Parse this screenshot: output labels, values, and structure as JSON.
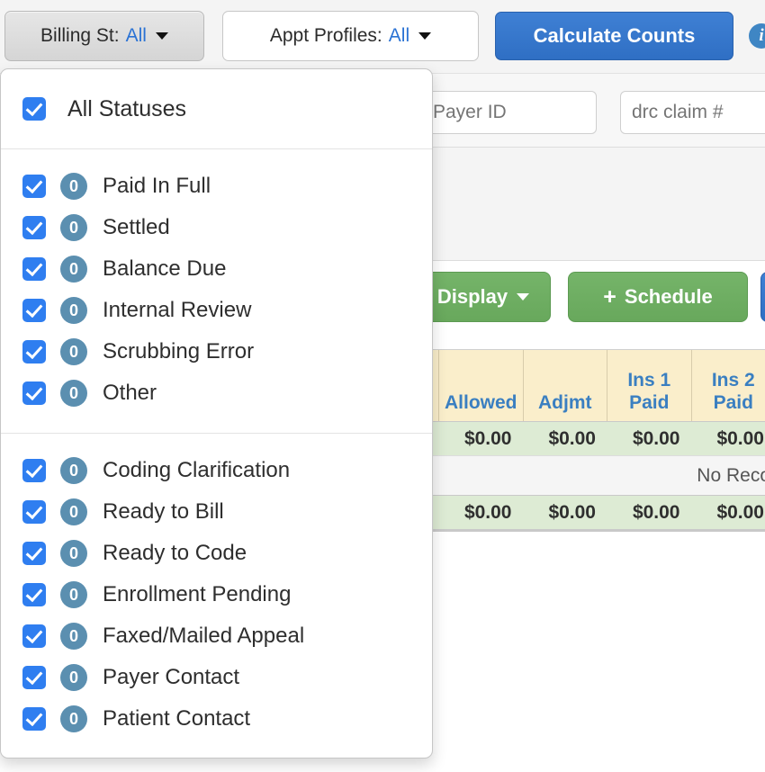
{
  "toolbar": {
    "billing_status_filter": {
      "label": "Billing St:",
      "value": "All",
      "icon": "chevron-down-icon"
    },
    "appt_profiles_filter": {
      "label": "Appt Profiles:",
      "value": "All",
      "icon": "chevron-down-icon"
    },
    "calculate_counts_label": "Calculate Counts",
    "info_icon": "i"
  },
  "filters": {
    "payer_id_placeholder": "Payer ID",
    "payer_id_value": "",
    "claim_placeholder": "drc claim #",
    "claim_value": ""
  },
  "actions": {
    "display_label": "Display",
    "schedule_label": "Schedule",
    "schedule_plus": "+"
  },
  "table": {
    "headers": [
      {
        "line1": "",
        "line2": ""
      },
      {
        "line1": "",
        "line2": "Allowed"
      },
      {
        "line1": "",
        "line2": "Adjmt"
      },
      {
        "line1": "Ins 1",
        "line2": "Paid"
      },
      {
        "line1": "Ins 2",
        "line2": "Paid"
      }
    ],
    "summary_top": [
      "",
      "$0.00",
      "$0.00",
      "$0.00",
      "$0.00"
    ],
    "no_records_text": "No Reco",
    "summary_bottom": [
      "",
      "$0.00",
      "$0.00",
      "$0.00",
      "$0.00"
    ]
  },
  "status_dropdown": {
    "select_all": {
      "label": "All Statuses",
      "checked": true
    },
    "group_1": [
      {
        "count": "0",
        "label": "Paid In Full",
        "checked": true
      },
      {
        "count": "0",
        "label": "Settled",
        "checked": true
      },
      {
        "count": "0",
        "label": "Balance Due",
        "checked": true
      },
      {
        "count": "0",
        "label": "Internal Review",
        "checked": true
      },
      {
        "count": "0",
        "label": "Scrubbing Error",
        "checked": true
      },
      {
        "count": "0",
        "label": "Other",
        "checked": true
      }
    ],
    "group_2": [
      {
        "count": "0",
        "label": "Coding Clarification",
        "checked": true
      },
      {
        "count": "0",
        "label": "Ready to Bill",
        "checked": true
      },
      {
        "count": "0",
        "label": "Ready to Code",
        "checked": true
      },
      {
        "count": "0",
        "label": "Enrollment Pending",
        "checked": true
      },
      {
        "count": "0",
        "label": "Faxed/Mailed Appeal",
        "checked": true
      },
      {
        "count": "0",
        "label": "Payer Contact",
        "checked": true
      },
      {
        "count": "0",
        "label": "Patient Contact",
        "checked": true
      }
    ]
  },
  "colors": {
    "accent_blue": "#2f7ef0",
    "primary_button_blue": "#3f80d4",
    "badge_steel": "#5b8fb0",
    "action_green": "#75b469",
    "table_header_cream": "#faeecb",
    "table_summary_green": "#ddebd4",
    "link_blue": "#2a72d4"
  }
}
